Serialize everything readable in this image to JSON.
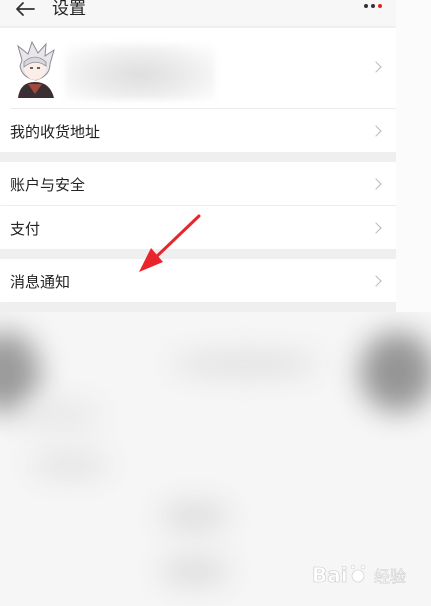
{
  "header": {
    "title": "设置",
    "back_icon": "arrow-left-icon",
    "more_icon": "more-dots-icon"
  },
  "profile": {
    "avatar_icon": "user-avatar"
  },
  "menu": {
    "address": "我的收货地址",
    "account_security": "账户与安全",
    "payment": "支付",
    "notifications": "消息通知"
  },
  "colors": {
    "accent": "#e1251b",
    "background": "#efefef",
    "row_bg": "#ffffff",
    "arrow": "#e8252a"
  },
  "watermark": {
    "text": "Bai度 经验"
  }
}
